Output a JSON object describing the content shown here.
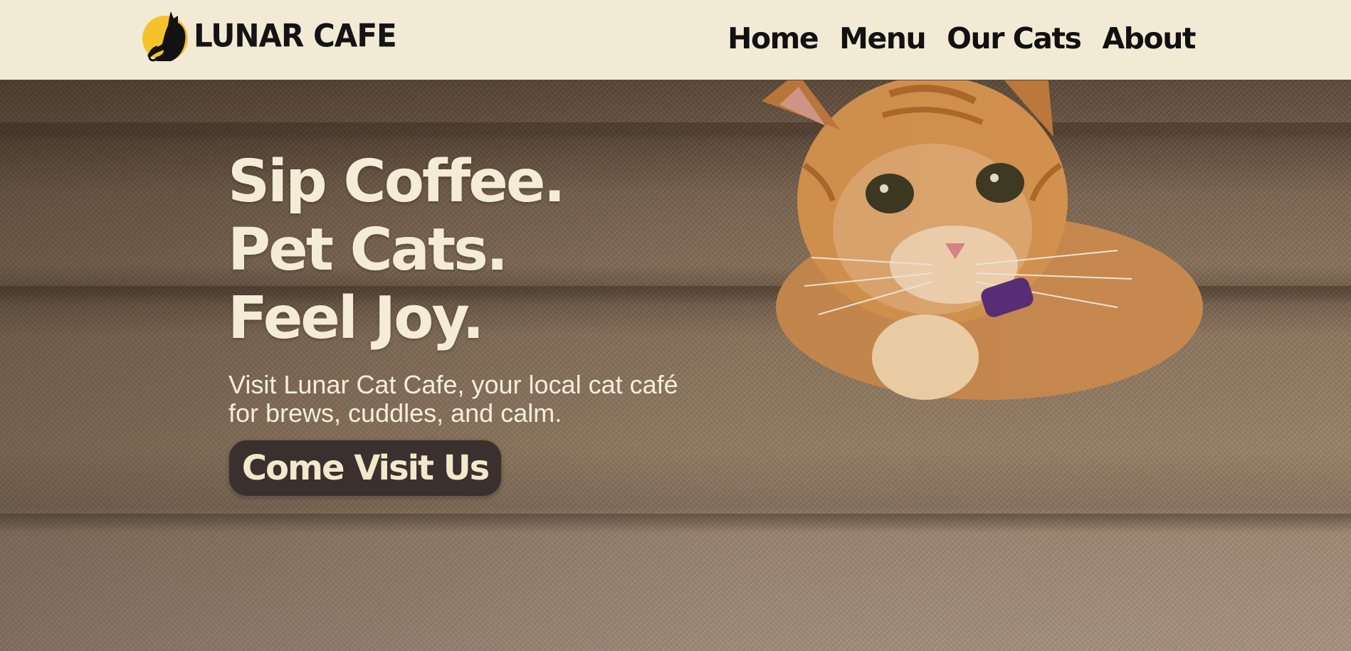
{
  "header": {
    "brand_name": "LUNAR CAFE",
    "logo_icon": "moon-cat-logo-icon",
    "nav": [
      {
        "label": "Home"
      },
      {
        "label": "Menu"
      },
      {
        "label": "Our Cats"
      },
      {
        "label": "About"
      }
    ]
  },
  "hero": {
    "headline_lines": [
      "Sip Coffee.",
      "Pet Cats.",
      "Feel Joy."
    ],
    "subtext": "Visit Lunar Cat Cafe, your local cat café for brews, cuddles, and calm.",
    "cta_label": "Come Visit Us",
    "background_image": "kitten-on-carpeted-stairs"
  },
  "colors": {
    "header_bg": "#f3ead6",
    "logo_moon": "#f6c22b",
    "headline": "#f5ecd6",
    "cta_bg": "#3a302d",
    "cta_text": "#f4e8cc"
  }
}
